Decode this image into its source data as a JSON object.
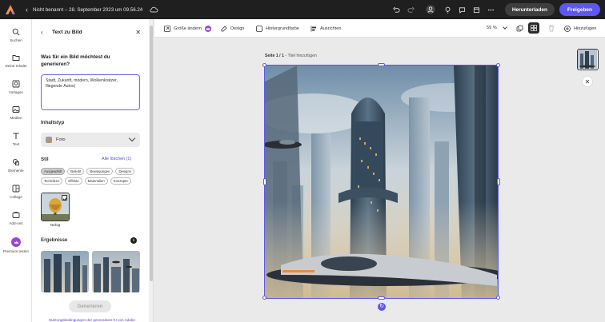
{
  "app": {
    "document_title": "Nicht benannt – 28. September 2023 um 09.56.24",
    "download_label": "Herunterladen",
    "share_label": "Freigeben",
    "brand_color": "#5d57f0"
  },
  "rail": {
    "items": [
      {
        "label": "Suchen",
        "icon": "search-icon"
      },
      {
        "label": "Deine Inhalte",
        "icon": "folder-icon"
      },
      {
        "label": "Vorlagen",
        "icon": "templates-icon"
      },
      {
        "label": "Medien",
        "icon": "media-icon"
      },
      {
        "label": "Text",
        "icon": "text-icon"
      },
      {
        "label": "Elemente",
        "icon": "shapes-icon"
      },
      {
        "label": "Collage",
        "icon": "collage-icon"
      },
      {
        "label": "Add-ons",
        "icon": "add-ons-icon"
      },
      {
        "label": "Premium testen",
        "icon": "premium-icon"
      }
    ]
  },
  "panel": {
    "title": "Text zu Bild",
    "prompt_question": "Was für ein Bild möchtest du generieren?",
    "prompt_value": "Stadt, Zukunft, modern, Wolkenkratzer, fliegende Autos|",
    "content_type_label": "Inhaltstyp",
    "content_type_value": "Foto",
    "style_label": "Stil",
    "clear_all_label": "Alle löschen (1)",
    "style_chips": [
      {
        "label": "Ausgewählt",
        "active": true
      },
      {
        "label": "Beliebt",
        "active": false
      },
      {
        "label": "Bewegungen",
        "active": false
      },
      {
        "label": "Designs",
        "active": false
      },
      {
        "label": "Techniken",
        "active": false
      },
      {
        "label": "Effekte",
        "active": false
      },
      {
        "label": "Materialien",
        "active": false
      },
      {
        "label": "Konzepte",
        "active": false
      }
    ],
    "selected_style_caption": "Nebig",
    "results_label": "Ergebnisse",
    "generate_label": "Generieren",
    "terms_label": "Nutzungsbedingungen der generativen KI von Adobe"
  },
  "toolbar": {
    "resize_label": "Größe ändern",
    "design_label": "Design",
    "background_label": "Hintergrundfarbe",
    "align_label": "Ausrichten",
    "zoom_value": "59 %",
    "add_label": "Hinzufügen"
  },
  "canvas": {
    "page_label": "Seite 1 / 1",
    "page_title_placeholder": " - Titel hinzufügen"
  }
}
